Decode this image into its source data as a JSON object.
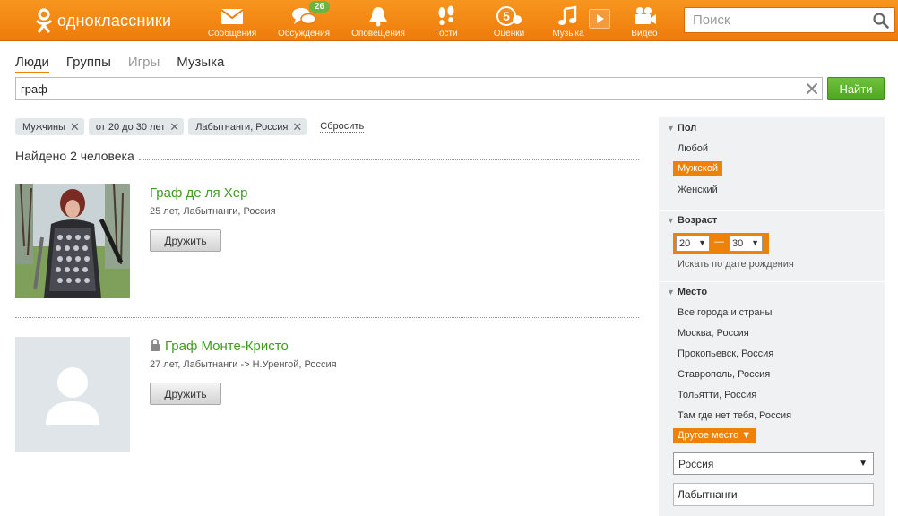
{
  "header": {
    "logo_text": "одноклассники",
    "nav": [
      {
        "label": "Сообщения",
        "icon": "envelope-icon"
      },
      {
        "label": "Обсуждения",
        "icon": "chat-bubbles-icon",
        "badge": "26"
      },
      {
        "label": "Оповещения",
        "icon": "bell-icon"
      },
      {
        "label": "Гости",
        "icon": "footprints-icon"
      },
      {
        "label": "Оценки",
        "icon": "rating-five-icon"
      },
      {
        "label": "Музыка",
        "icon": "music-note-icon"
      },
      {
        "label": "Видео",
        "icon": "video-camera-icon"
      }
    ],
    "search_placeholder": "Поиск",
    "accent_color": "#ee8208"
  },
  "tabs": [
    {
      "label": "Люди",
      "active": true
    },
    {
      "label": "Группы"
    },
    {
      "label": "Игры",
      "disabled": true
    },
    {
      "label": "Музыка"
    }
  ],
  "search": {
    "query": "граф",
    "button_label": "Найти"
  },
  "filters": {
    "chips": [
      "Мужчины",
      "от 20 до 30 лет",
      "Лабытнанги, Россия"
    ],
    "reset_label": "Сбросить"
  },
  "results": {
    "summary": "Найдено 2 человека",
    "items": [
      {
        "name": "Граф де ля Хер",
        "info": "25 лет, Лабытнанги, Россия",
        "button": "Дружить",
        "locked": false
      },
      {
        "name": "Граф Монте-Кристо",
        "info": "27 лет, Лабытнанги -> Н.Уренгой, Россия",
        "button": "Дружить",
        "locked": true
      }
    ]
  },
  "sidebar": {
    "gender": {
      "title": "Пол",
      "options": [
        "Любой",
        "Мужской",
        "Женский"
      ],
      "selected": "Мужской"
    },
    "age": {
      "title": "Возраст",
      "from": "20",
      "to": "30",
      "separator": "—",
      "dob_link": "Искать по дате рождения"
    },
    "place": {
      "title": "Место",
      "options": [
        "Все города и страны",
        "Москва, Россия",
        "Прокопьевск, Россия",
        "Ставрополь, Россия",
        "Тольятти, Россия",
        "Там где нет тебя, Россия"
      ],
      "other_label": "Другое место ▼",
      "country": "Россия",
      "city": "Лабытнанги"
    }
  }
}
